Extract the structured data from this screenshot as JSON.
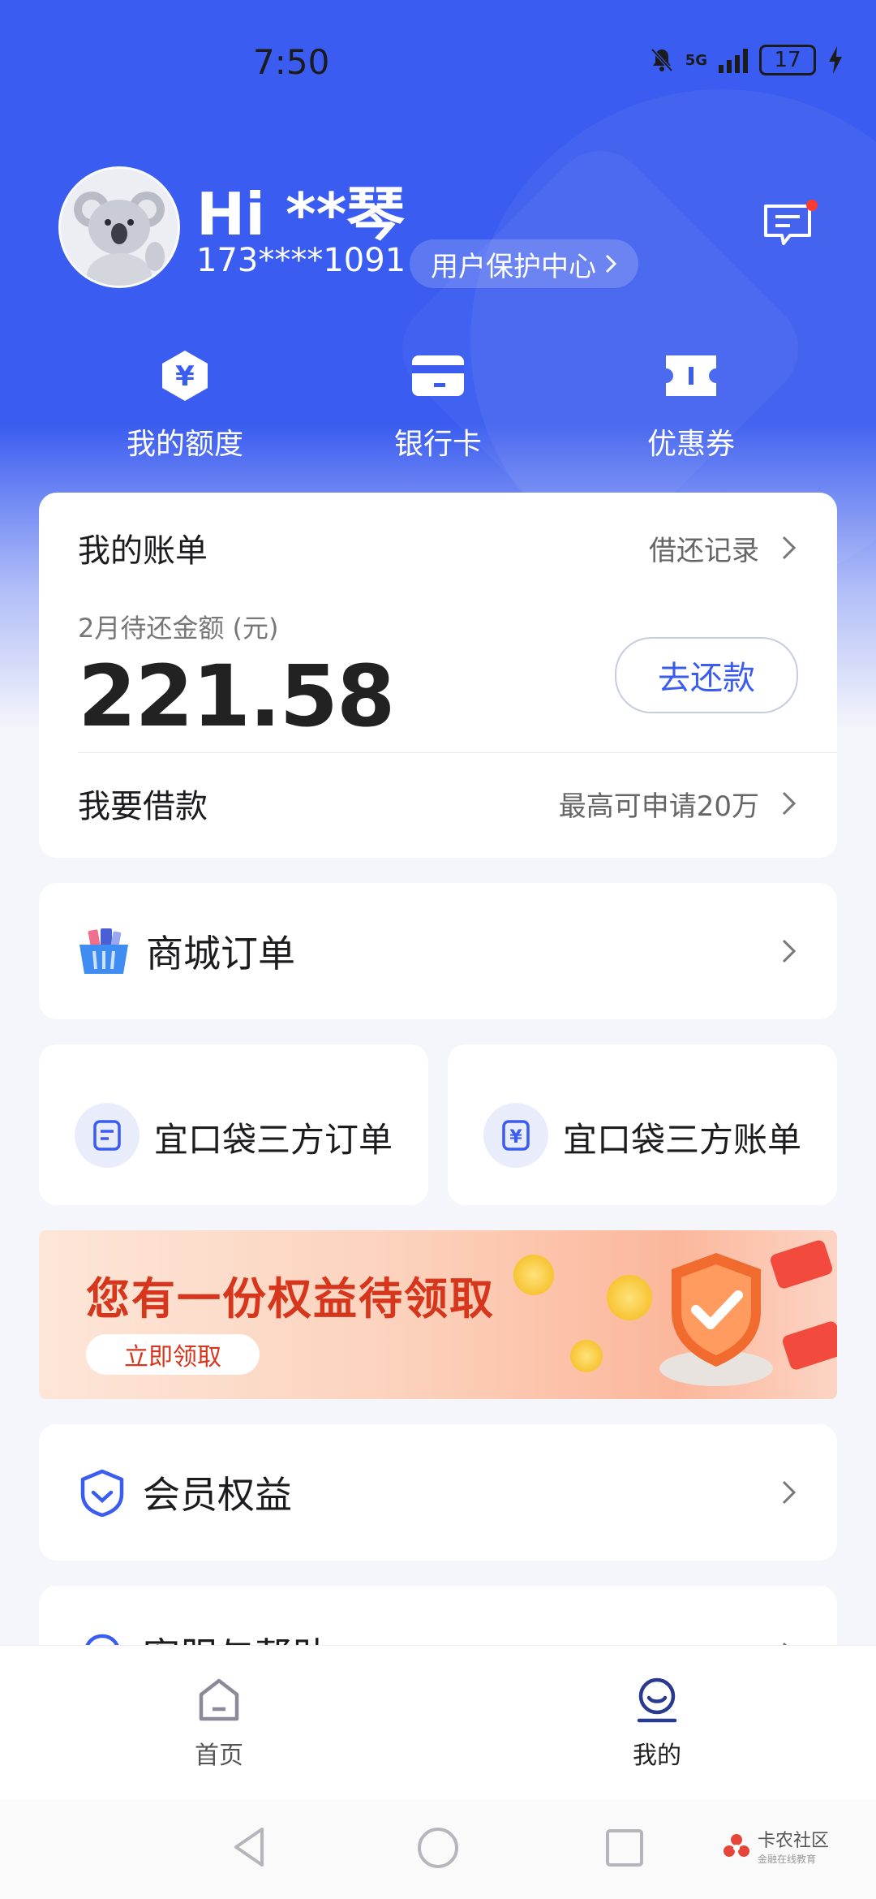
{
  "status_bar": {
    "time": "7:50",
    "network": "5G",
    "battery": "17"
  },
  "profile": {
    "greeting": "Hi **琴",
    "phone": "173****1091",
    "protection_center": "用户保护中心"
  },
  "quick_actions": [
    {
      "label": "我的额度",
      "icon": "yen-hexagon-icon"
    },
    {
      "label": "银行卡",
      "icon": "bank-card-icon"
    },
    {
      "label": "优惠券",
      "icon": "ticket-icon"
    }
  ],
  "bill": {
    "title": "我的账单",
    "history_link": "借还记录",
    "amount_label": "2月待还金额 (元)",
    "amount": "221.58",
    "repay_button": "去还款",
    "borrow_label": "我要借款",
    "borrow_hint": "最高可申请20万"
  },
  "mall_orders": {
    "label": "商城订单",
    "icon": "shopping-basket-icon"
  },
  "third_party": [
    {
      "label": "宜口袋三方订单",
      "icon": "order-doc-icon"
    },
    {
      "label": "宜口袋三方账单",
      "icon": "yen-doc-icon"
    }
  ],
  "banner": {
    "title": "您有一份权益待领取",
    "button": "立即领取"
  },
  "member": {
    "label": "会员权益",
    "icon": "shield-icon"
  },
  "service": {
    "label": "客服与帮助",
    "icon": "headset-icon"
  },
  "bottom_nav": [
    {
      "label": "首页",
      "icon": "home-icon",
      "active": false
    },
    {
      "label": "我的",
      "icon": "profile-icon",
      "active": true
    }
  ],
  "watermark": {
    "title": "卡农社区",
    "subtitle": "金融在线教育"
  },
  "colors": {
    "primary": "#3a5cf0",
    "banner_red": "#d6361c",
    "notify_dot": "#ff3b30"
  }
}
